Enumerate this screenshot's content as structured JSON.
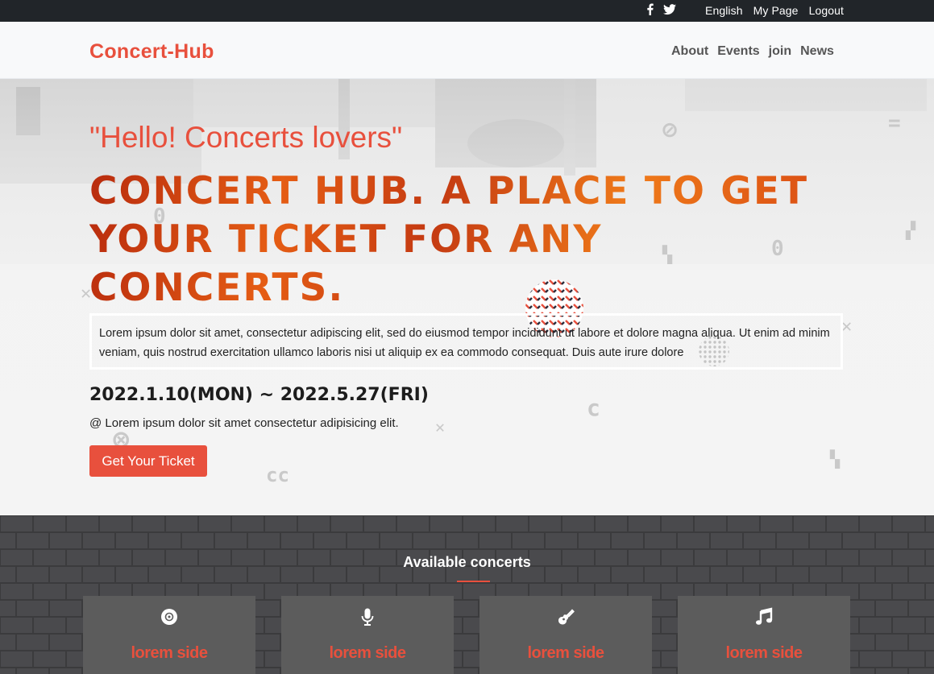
{
  "topbar": {
    "social": [
      {
        "icon": "facebook-icon"
      },
      {
        "icon": "twitter-icon"
      }
    ],
    "links": [
      "English",
      "My Page",
      "Logout"
    ]
  },
  "navbar": {
    "brand": "Concert-Hub",
    "menu": [
      "About",
      "Events",
      "join",
      "News"
    ]
  },
  "hero": {
    "greeting": "\"Hello! Concerts lovers\"",
    "headline": "CONCERT HUB. A PLACE TO GET YOUR TICKET FOR ANY CONCERTS.",
    "intro": "Lorem ipsum dolor sit amet, consectetur adipiscing elit, sed do eiusmod tempor incididunt ut labore et dolore magna aliqua. Ut enim ad minim veniam, quis nostrud exercitation ullamco laboris nisi ut aliquip ex ea commodo consequat. Duis aute irure dolore",
    "dates": "2022.1.10(MON) ~ 2022.5.27(FRI)",
    "venue": "@ Lorem ipsum dolor sit amet consectetur adipisicing elit.",
    "cta": "Get Your Ticket"
  },
  "concerts": {
    "title": "Available concerts",
    "cards": [
      {
        "icon": "vinyl-disc-icon",
        "label": "lorem side"
      },
      {
        "icon": "microphone-icon",
        "label": "lorem side"
      },
      {
        "icon": "guitar-icon",
        "label": "lorem side"
      },
      {
        "icon": "music-note-icon",
        "label": "lorem side"
      }
    ]
  },
  "colors": {
    "accent": "#e8503d",
    "topbar": "#212529",
    "brick_wall": "#3b3b3d",
    "card": "#5c5c5c"
  }
}
